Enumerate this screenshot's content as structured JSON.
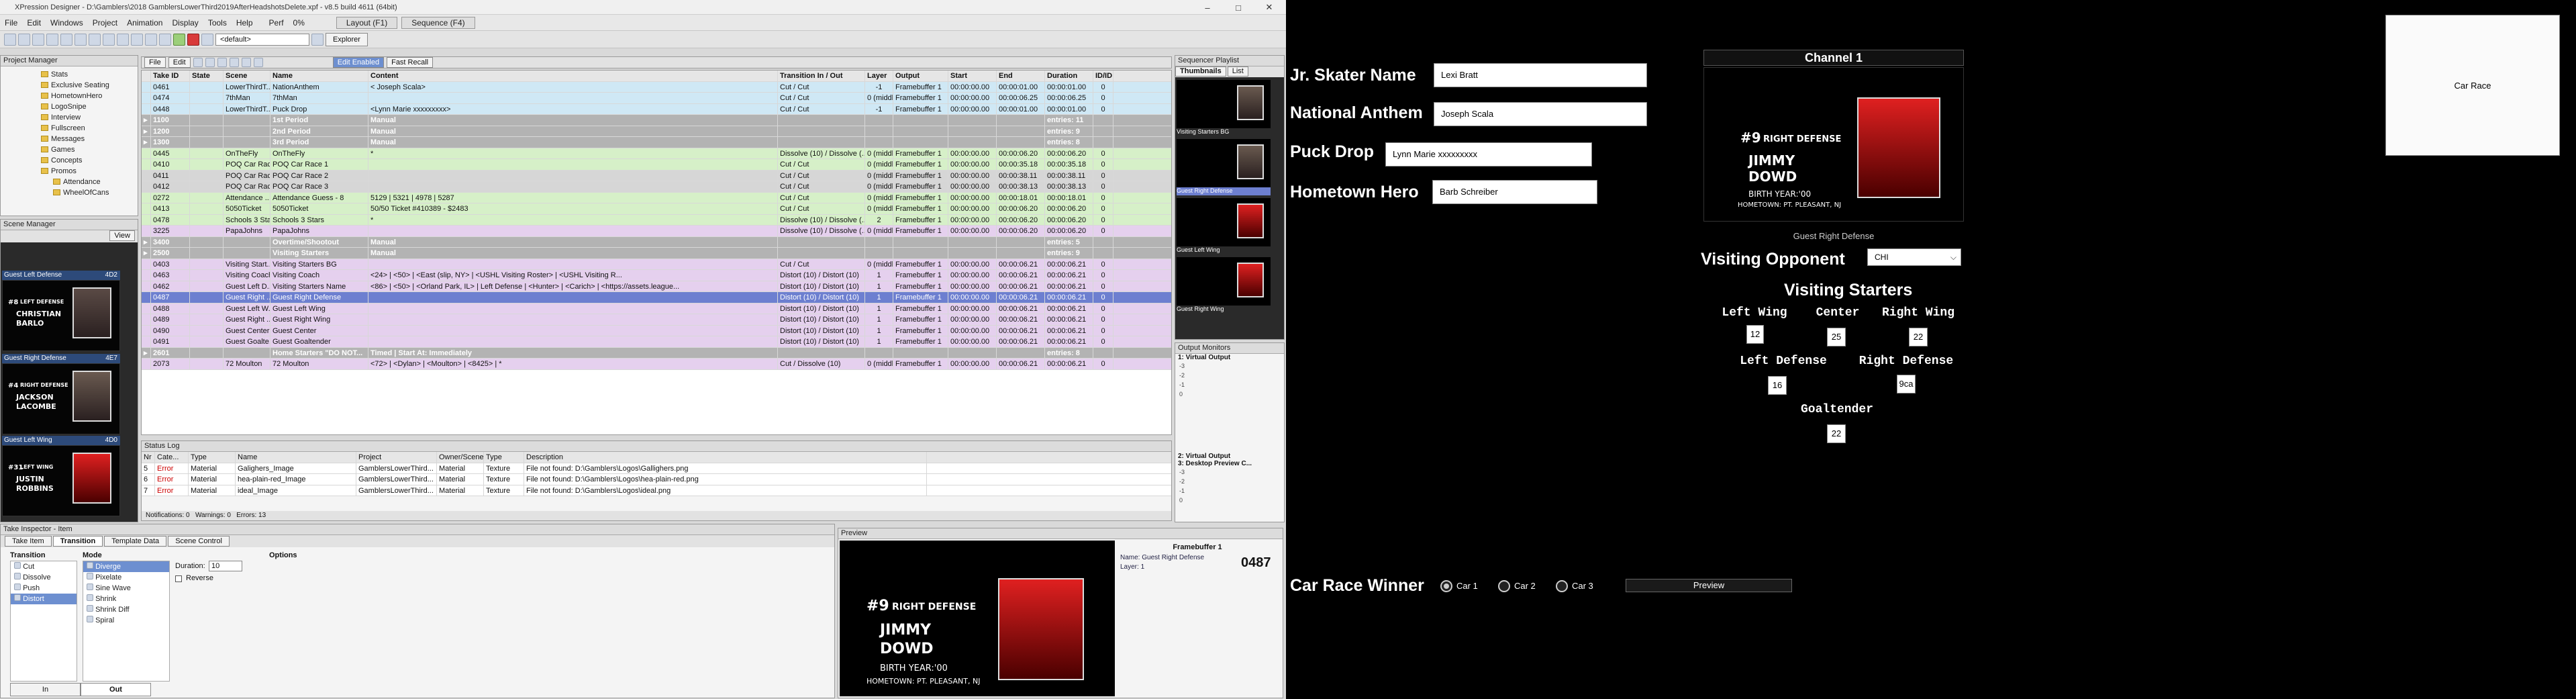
{
  "app": {
    "title": "XPression Designer - D:\\Gamblers\\2018 GamblersLowerThird2019AfterHeadshotsDelete.xpf - v8.5 build 4611 (64bit)",
    "menus": [
      "File",
      "Edit",
      "Windows",
      "Project",
      "Animation",
      "Display",
      "Tools",
      "Help"
    ],
    "perf_label": "Perf",
    "perf_value": "0%",
    "layout_label": "Layout (F1)",
    "sequence_label": "Sequence (F4)",
    "default_select": "<default>",
    "explorer_label": "Explorer"
  },
  "project_manager": {
    "title": "Project Manager",
    "items": [
      "Stats",
      "Exclusive Seating",
      "HometownHero",
      "LogoSnipe",
      "Interview",
      "Fullscreen",
      "Messages",
      "Games",
      "Concepts",
      "Promos",
      "Attendance",
      "WheelOfCans"
    ]
  },
  "scene_manager": {
    "title": "Scene Manager",
    "view_label": "View",
    "thumbs": [
      {
        "label": "Guest Left Defense",
        "id": "4D2",
        "position": "LEFT DEFENSE",
        "name1": "CHRISTIAN",
        "name2": "BARLO",
        "num": "#8"
      },
      {
        "label": "Guest Right Defense",
        "id": "4E7",
        "position": "RIGHT DEFENSE",
        "name1": "JACKSON",
        "name2": "LACOMBE",
        "num": "#4"
      },
      {
        "label": "Guest Left Wing",
        "id": "4D0",
        "position": "LEFT WING",
        "name1": "JUSTIN",
        "name2": "ROBBINS",
        "num": "#31"
      }
    ]
  },
  "take_list": {
    "tab_file": "File",
    "tab_edit": "Edit",
    "edit_enabled": "Edit Enabled",
    "fast_recall": "Fast Recall",
    "columns": [
      "Take ID",
      "State",
      "Scene",
      "Name",
      "Content",
      "Transition In / Out",
      "Layer",
      "Output",
      "Start",
      "End",
      "Duration",
      "ID/ID"
    ],
    "rows": [
      {
        "kind": "item",
        "id": "0461",
        "scene": "LowerThirdT...",
        "name": "NationAnthem",
        "content": "< Joseph Scala>",
        "trans": "Cut / Cut",
        "layer": "-1",
        "output": "Framebuffer 1",
        "start": "00:00:00.00",
        "end": "00:00:01.00",
        "dur": "00:00:01.00",
        "x": "0",
        "bg": "#cfe8f5"
      },
      {
        "kind": "item",
        "id": "0474",
        "scene": "7thMan",
        "name": "7thMan",
        "content": "",
        "trans": "Cut / Cut",
        "layer": "0 (middle)",
        "output": "Framebuffer 1",
        "start": "00:00:00.00",
        "end": "00:00:06.25",
        "dur": "00:00:06.25",
        "x": "0",
        "bg": "#cfe8f5"
      },
      {
        "kind": "item",
        "id": "0448",
        "scene": "LowerThirdT...",
        "name": "Puck Drop",
        "content": "<Lynn Marie xxxxxxxxx>",
        "trans": "Cut / Cut",
        "layer": "-1",
        "output": "Framebuffer 1",
        "start": "00:00:00.00",
        "end": "00:00:01.00",
        "dur": "00:00:01.00",
        "x": "0",
        "bg": "#cfe8f5"
      },
      {
        "kind": "group",
        "id": "1100",
        "name": "1st Period",
        "content": "Manual",
        "count": "entries: 11"
      },
      {
        "kind": "group",
        "id": "1200",
        "name": "2nd Period",
        "content": "Manual",
        "count": "entries: 9"
      },
      {
        "kind": "group",
        "id": "1300",
        "name": "3rd Period",
        "content": "Manual",
        "count": "entries: 8"
      },
      {
        "kind": "item",
        "id": "0445",
        "scene": "OnTheFly",
        "name": "OnTheFly",
        "content": "*",
        "trans": "Dissolve (10) / Dissolve (...",
        "layer": "0 (middle)",
        "output": "Framebuffer 1",
        "start": "00:00:00.00",
        "end": "00:00:06.20",
        "dur": "00:00:06.20",
        "x": "0",
        "bg": "#d6f0c8"
      },
      {
        "kind": "item",
        "id": "0410",
        "scene": "POQ Car Rac...",
        "name": "POQ Car Race 1",
        "content": "",
        "trans": "Cut / Cut",
        "layer": "0 (middle)",
        "output": "Framebuffer 1",
        "start": "00:00:00.00",
        "end": "00:00:35.18",
        "dur": "00:00:35.18",
        "x": "0",
        "bg": "#d6f0c8"
      },
      {
        "kind": "item",
        "id": "0411",
        "scene": "POQ Car Rac...",
        "name": "POQ Car Race 2",
        "content": "",
        "trans": "Cut / Cut",
        "layer": "0 (middle)",
        "output": "Framebuffer 1",
        "start": "00:00:00.00",
        "end": "00:00:38.11",
        "dur": "00:00:38.11",
        "x": "0",
        "bg": "#d6d6d6"
      },
      {
        "kind": "item",
        "id": "0412",
        "scene": "POQ Car Rac...",
        "name": "POQ Car Race 3",
        "content": "",
        "trans": "Cut / Cut",
        "layer": "0 (middle)",
        "output": "Framebuffer 1",
        "start": "00:00:00.00",
        "end": "00:00:38.13",
        "dur": "00:00:38.13",
        "x": "0",
        "bg": "#d6d6d6"
      },
      {
        "kind": "item",
        "id": "0272",
        "scene": "Attendance ...",
        "name": "Attendance Guess - 8",
        "content": "5129 | 5321 | 4978 | 5287",
        "trans": "Cut / Cut",
        "layer": "0 (middle)",
        "output": "Framebuffer 1",
        "start": "00:00:00.00",
        "end": "00:00:18.01",
        "dur": "00:00:18.01",
        "x": "0",
        "bg": "#d6f0c8"
      },
      {
        "kind": "item",
        "id": "0413",
        "scene": "5050Ticket",
        "name": "5050Ticket",
        "content": "50/50 Ticket #410389 - $2483",
        "trans": "Cut / Cut",
        "layer": "0 (middle)",
        "output": "Framebuffer 1",
        "start": "00:00:00.00",
        "end": "00:00:06.20",
        "dur": "00:00:06.20",
        "x": "0",
        "bg": "#d6f0c8"
      },
      {
        "kind": "item",
        "id": "0478",
        "scene": "Schools 3 Stars",
        "name": "Schools 3 Stars",
        "content": "*",
        "trans": "Dissolve (10) / Dissolve (...",
        "layer": "2",
        "output": "Framebuffer 1",
        "start": "00:00:00.00",
        "end": "00:00:06.20",
        "dur": "00:00:06.20",
        "x": "0",
        "bg": "#d6f0c8"
      },
      {
        "kind": "item",
        "id": "3225",
        "scene": "PapaJohns",
        "name": "PapaJohns",
        "content": "",
        "trans": "Dissolve (10) / Dissolve (...",
        "layer": "0 (middle)",
        "output": "Framebuffer 1",
        "start": "00:00:00.00",
        "end": "00:00:06.20",
        "dur": "00:00:06.20",
        "x": "0",
        "bg": "#e5d0ee"
      },
      {
        "kind": "group",
        "id": "3400",
        "name": "Overtime/Shootout",
        "content": "Manual",
        "count": "entries: 5"
      },
      {
        "kind": "group",
        "id": "2500",
        "name": "Visiting Starters",
        "content": "Manual",
        "count": "entries: 9"
      },
      {
        "kind": "item",
        "id": "0403",
        "scene": "Visiting Start...",
        "name": "Visiting Starters BG",
        "content": "",
        "trans": "Cut / Cut",
        "layer": "0 (middle)",
        "output": "Framebuffer 1",
        "start": "00:00:00.00",
        "end": "00:00:06.21",
        "dur": "00:00:06.21",
        "x": "0",
        "bg": "#e5d0ee"
      },
      {
        "kind": "item",
        "id": "0463",
        "scene": "Visiting Coach",
        "name": "Visiting Coach",
        "content": "<24> | <50> | <East (slip, NY> | <USHL Visiting Roster> | <USHL Visiting R...",
        "trans": "Distort (10) / Distort (10)",
        "layer": "1",
        "output": "Framebuffer 1",
        "start": "00:00:00.00",
        "end": "00:00:06.21",
        "dur": "00:00:06.21",
        "x": "0",
        "bg": "#e5d0ee"
      },
      {
        "kind": "item",
        "id": "0462",
        "scene": "Guest Left D...",
        "name": "Visiting Starters Name",
        "content": "<86> | <50> | <Orland Park, IL> | Left Defense | <Hunter> | <Carich> | <https://assets.league...",
        "trans": "Distort (10) / Distort (10)",
        "layer": "1",
        "output": "Framebuffer 1",
        "start": "00:00:00.00",
        "end": "00:00:06.21",
        "dur": "00:00:06.21",
        "x": "0",
        "bg": "#e5d0ee"
      },
      {
        "kind": "item",
        "id": "0487",
        "scene": "Guest Right ...",
        "name": "Guest Right Defense",
        "content": "",
        "trans": "Distort (10) / Distort (10)",
        "layer": "1",
        "output": "Framebuffer 1",
        "start": "00:00:00.00",
        "end": "00:00:06.21",
        "dur": "00:00:06.21",
        "x": "0",
        "bg": "#6d7fd0"
      },
      {
        "kind": "item",
        "id": "0488",
        "scene": "Guest Left W...",
        "name": "Guest Left Wing",
        "content": "",
        "trans": "Distort (10) / Distort (10)",
        "layer": "1",
        "output": "Framebuffer 1",
        "start": "00:00:00.00",
        "end": "00:00:06.21",
        "dur": "00:00:06.21",
        "x": "0",
        "bg": "#e5d0ee"
      },
      {
        "kind": "item",
        "id": "0489",
        "scene": "Guest Right ...",
        "name": "Guest Right Wing",
        "content": "",
        "trans": "Distort (10) / Distort (10)",
        "layer": "1",
        "output": "Framebuffer 1",
        "start": "00:00:00.00",
        "end": "00:00:06.21",
        "dur": "00:00:06.21",
        "x": "0",
        "bg": "#e5d0ee"
      },
      {
        "kind": "item",
        "id": "0490",
        "scene": "Guest Center",
        "name": "Guest Center",
        "content": "",
        "trans": "Distort (10) / Distort (10)",
        "layer": "1",
        "output": "Framebuffer 1",
        "start": "00:00:00.00",
        "end": "00:00:06.21",
        "dur": "00:00:06.21",
        "x": "0",
        "bg": "#e5d0ee"
      },
      {
        "kind": "item",
        "id": "0491",
        "scene": "Guest Goalte...",
        "name": "Guest Goaltender",
        "content": "",
        "trans": "Distort (10) / Distort (10)",
        "layer": "1",
        "output": "Framebuffer 1",
        "start": "00:00:00.00",
        "end": "00:00:06.21",
        "dur": "00:00:06.21",
        "x": "0",
        "bg": "#e5d0ee"
      },
      {
        "kind": "group",
        "id": "2601",
        "name": "Home Starters \"DO NOT...",
        "content": "Timed | Start At: Immediately",
        "count": "entries: 8"
      },
      {
        "kind": "item",
        "id": "2073",
        "scene": "72 Moulton",
        "name": "72 Moulton",
        "content": "<72> | <Dylan> | <Moulton> | <8425> | *",
        "trans": "Cut / Dissolve (10)",
        "layer": "0 (middle)",
        "output": "Framebuffer 1",
        "start": "00:00:00.00",
        "end": "00:00:06.21",
        "dur": "00:00:06.21",
        "x": "0",
        "bg": "#e5d0ee"
      }
    ]
  },
  "status_log": {
    "title": "Status Log",
    "columns": [
      "Nr",
      "Cate...",
      "Type",
      "Name",
      "Project",
      "Owner/Scene",
      "Type",
      "Description"
    ],
    "rows": [
      {
        "nr": "5",
        "cat": "Error",
        "type": "Material",
        "name": "Galighers_Image",
        "project": "GamblersLowerThird...",
        "owner": "Material",
        "type2": "Texture",
        "desc": "File not found: D:\\Gamblers\\Logos\\Gallighers.png"
      },
      {
        "nr": "6",
        "cat": "Error",
        "type": "Material",
        "name": "hea-plain-red_Image",
        "project": "GamblersLowerThird...",
        "owner": "Material",
        "type2": "Texture",
        "desc": "File not found: D:\\Gamblers\\Logos\\hea-plain-red.png"
      },
      {
        "nr": "7",
        "cat": "Error",
        "type": "Material",
        "name": "ideal_Image",
        "project": "GamblersLowerThird...",
        "owner": "Material",
        "type2": "Texture",
        "desc": "File not found: D:\\Gamblers\\Logos\\ideal.png"
      }
    ],
    "notifications": "Notifications: 0",
    "warnings": "Warnings: 0",
    "errors": "Errors: 13"
  },
  "take_inspector": {
    "title": "Take Inspector - Item",
    "tabs": [
      "Take Item",
      "Transition",
      "Template Data",
      "Scene Control"
    ],
    "transition_header": "Transition",
    "mode_header": "Mode",
    "options_header": "Options",
    "transitions": [
      "Cut",
      "Dissolve",
      "Push",
      "Distort"
    ],
    "modes": [
      "Diverge",
      "Pixelate",
      "Sine Wave",
      "Shrink",
      "Shrink Diff",
      "Spiral"
    ],
    "duration_label": "Duration:",
    "duration_value": "10",
    "reverse_label": "Reverse",
    "in_label": "In",
    "out_label": "Out"
  },
  "preview": {
    "title": "Preview",
    "framebuffer": "Framebuffer 1",
    "name_label": "Name:",
    "name_value": "Guest Right Defense",
    "layer_label": "Layer:",
    "layer_value": "1",
    "take_id": "0487"
  },
  "graphic": {
    "position": "RIGHT DEFENSE",
    "number": "#9",
    "name1": "JIMMY",
    "name2": "DOWD",
    "birth": "BIRTH YEAR:'00",
    "hometown": "HOMETOWN: PT. PLEASANT, NJ"
  },
  "sequencer": {
    "title": "Sequencer Playlist",
    "tabs": [
      "Thumbnails",
      "List"
    ],
    "items": [
      "Visiting Starters BG",
      "Guest Right Defense",
      "Guest Left Wing",
      "Guest Right Wing"
    ]
  },
  "output_monitors": {
    "title": "Output Monitors",
    "virtual1": "1: Virtual Output",
    "virtual2": "2: Virtual Output",
    "desktop": "3: Desktop Preview C...",
    "meter_labels": [
      "-3",
      "-2",
      "-1",
      "0"
    ]
  },
  "control": {
    "fields": [
      {
        "label": "Jr. Skater Name",
        "value": "Lexi Bratt"
      },
      {
        "label": "National Anthem",
        "value": "Joseph Scala"
      },
      {
        "label": "Puck Drop",
        "value": "Lynn Marie xxxxxxxxx"
      },
      {
        "label": "Hometown Hero",
        "value": "Barb Schreiber"
      }
    ],
    "channel_title": "Channel 1",
    "channel_caption": "Guest Right Defense",
    "car_race_button": "Car Race",
    "visiting_opponent_label": "Visiting Opponent",
    "visiting_opponent_value": "CHI",
    "visiting_starters_title": "Visiting Starters",
    "positions": [
      {
        "label": "Left Wing",
        "value": "12"
      },
      {
        "label": "Center",
        "value": "25"
      },
      {
        "label": "Right Wing",
        "value": "22"
      },
      {
        "label": "Left Defense",
        "value": "16"
      },
      {
        "label": "Right Defense",
        "value": "9ca"
      },
      {
        "label": "Goaltender",
        "value": "22"
      }
    ],
    "car_race_winner_label": "Car Race Winner",
    "cars": [
      "Car 1",
      "Car 2",
      "Car 3"
    ],
    "preview_button": "Preview"
  },
  "colors": {
    "accent_selection": "#6d7fd0",
    "graphic_red": "#d42020",
    "group_row": "#b3b3b3"
  }
}
